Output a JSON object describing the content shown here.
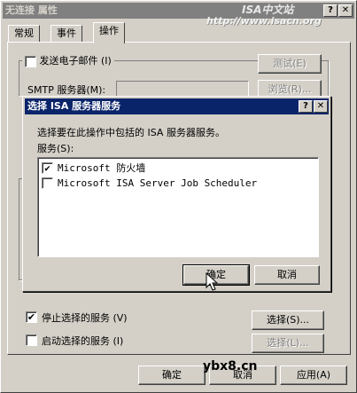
{
  "window": {
    "title": "无连接 属性",
    "watermark_line1": "ISA中文站",
    "watermark_line2": "http://www.isacn.org",
    "help_glyph": "?",
    "close_glyph": "✕"
  },
  "tabs": [
    {
      "label": "常规"
    },
    {
      "label": "事件"
    },
    {
      "label": "操作",
      "active": true
    }
  ],
  "email": {
    "checkbox_label": "发送电子邮件 (I)",
    "checked": false,
    "test_button": "测试(E)",
    "smtp_label": "SMTP 服务器(M):",
    "smtp_value": "",
    "browse_button": "浏览(R)..."
  },
  "dialog": {
    "title": "选择 ISA 服务器服务",
    "instruction": "选择要在此操作中包括的 ISA 服务器服务。",
    "services_label": "服务(S):",
    "services": [
      {
        "name": "Microsoft 防火墙",
        "checked": true
      },
      {
        "name": "Microsoft ISA Server Job Scheduler",
        "checked": false
      }
    ],
    "ok_button": "确定",
    "cancel_button": "取消"
  },
  "services": {
    "stop_label": "停止选择的服务 (V)",
    "stop_checked": true,
    "stop_select_button": "选择(S)...",
    "start_label": "启动选择的服务 (I)",
    "start_checked": false,
    "start_select_button": "选择(L)..."
  },
  "footer": {
    "ok": "确定",
    "cancel": "取消",
    "apply": "应用(A)",
    "watermark": "ybx8.cn"
  }
}
